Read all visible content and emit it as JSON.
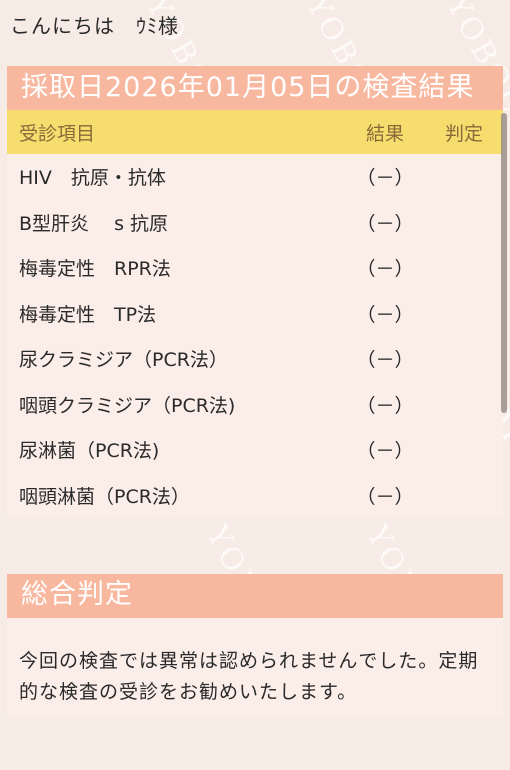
{
  "greeting": "こんにちは　ｳﾐ様",
  "result_section": {
    "title": "採取日2026年01月05日の検査結果",
    "columns": {
      "item": "受診項目",
      "result": "結果",
      "judge": "判定"
    },
    "rows": [
      {
        "item": "HIV　抗原・抗体",
        "result": "（－）",
        "judge": ""
      },
      {
        "item": "B型肝炎　 s 抗原",
        "result": "（－）",
        "judge": ""
      },
      {
        "item": "梅毒定性　RPR法",
        "result": "（－）",
        "judge": ""
      },
      {
        "item": "梅毒定性　TP法",
        "result": "（－）",
        "judge": ""
      },
      {
        "item": "尿クラミジア（PCR法）",
        "result": "（－）",
        "judge": ""
      },
      {
        "item": "咽頭クラミジア（PCR法)",
        "result": "（－）",
        "judge": ""
      },
      {
        "item": "尿淋菌（PCR法)",
        "result": "（－）",
        "judge": ""
      },
      {
        "item": "咽頭淋菌（PCR法）",
        "result": "（－）",
        "judge": ""
      }
    ]
  },
  "summary_section": {
    "title": "総合判定",
    "body": "今回の検査では異常は認められませんでした。定期的な検査の受診をお勧めいたします。"
  },
  "watermark_text": "YOBOUKAI",
  "colors": {
    "page_bg": "#f7ebe5",
    "header_bg": "#f8b8a0",
    "table_header_bg": "#f6dd6e",
    "table_header_text": "#8a6a3a"
  }
}
